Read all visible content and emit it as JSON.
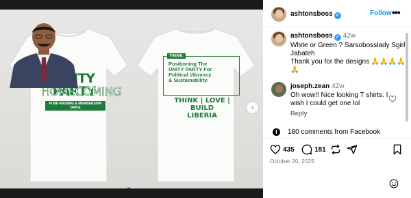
{
  "post": {
    "author": "ashtonsboss",
    "follow_label": "Follow",
    "more_label": "•••",
    "caption": {
      "author": "ashtonsboss",
      "time": "42w",
      "lines": [
        "White or Green ? Sarsobosslady Sgirl",
        "Jabateh",
        "Thank you for the designs 🙏🙏🙏🙏",
        "🙏"
      ]
    },
    "comment": {
      "author": "joseph.zean",
      "time": "42w",
      "lines": [
        "Oh wow!! Nice looking T shirts. I",
        "wish I could get one lol"
      ],
      "reply_label": "Reply"
    },
    "facebook_comments": "180 comments from Facebook",
    "likes": "435",
    "comments": "181",
    "date": "October 20, 2025"
  },
  "media": {
    "front_shirt": {
      "brand_line1": "UNITY PARTY",
      "brand_line2": "HOMECOMING",
      "brand_sub": "FUND-RAISING & MEMBERSHIP DRIVE"
    },
    "back_shirt": {
      "theme_label": "THEME:",
      "theme_lines": [
        "Positioning The",
        "UNITY PARTY For",
        "Political  Vibrancy",
        "& Sustainability."
      ],
      "slogan_lines": [
        "THINK | LOVE | BUILD",
        "LIBERIA"
      ]
    },
    "next_icon": "chevron-right-icon",
    "active_slide": 1,
    "slide_count": 2
  },
  "colors": {
    "brand_green": "#1e7b3a",
    "link_blue": "#0095f6",
    "verified_blue": "#3897f0",
    "muted": "#737373"
  },
  "icons": {
    "verified": "verified-badge-icon",
    "like": "heart-icon",
    "comment": "comment-bubble-icon",
    "share": "repost-icon",
    "send": "paper-plane-icon",
    "save": "bookmark-icon",
    "facebook": "facebook-icon",
    "emoji": "emoji-icon"
  }
}
